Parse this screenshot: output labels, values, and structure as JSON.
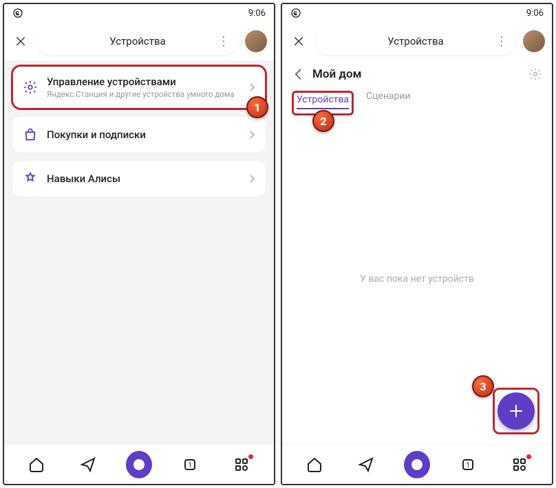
{
  "status": {
    "time": "9:06"
  },
  "header": {
    "title": "Устройства"
  },
  "screen1": {
    "cards": [
      {
        "title": "Управление устройствами",
        "sub": "Яндекс.Станция и другие устройства умного дома"
      },
      {
        "title": "Покупки и подписки"
      },
      {
        "title": "Навыки Алисы"
      }
    ],
    "badge1": "1"
  },
  "screen2": {
    "home_title": "Мой дом",
    "tabs": {
      "devices": "Устройства",
      "scenarios": "Сценарии"
    },
    "empty": "У вас пока нет устройств",
    "badge2": "2",
    "badge3": "3"
  }
}
